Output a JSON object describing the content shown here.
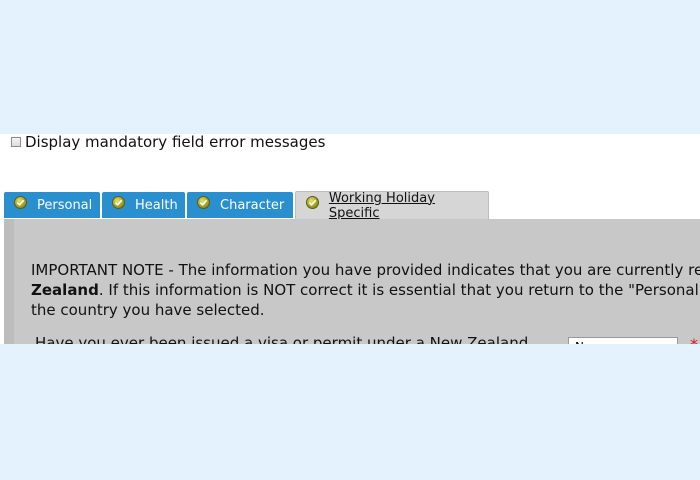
{
  "mandatory_checkbox": {
    "label": "Display mandatory field error messages",
    "checked": false
  },
  "tabs": [
    {
      "label": "Personal",
      "status_icon": "check-circle-icon",
      "active": false
    },
    {
      "label": "Health",
      "status_icon": "check-circle-icon",
      "active": false
    },
    {
      "label": "Character",
      "status_icon": "check-circle-icon",
      "active": false
    },
    {
      "label": "Working Holiday Specific",
      "status_icon": "check-circle-icon",
      "active": true
    }
  ],
  "panel": {
    "note_line1": "IMPORTANT NOTE - The information you have provided indicates that you are currently re",
    "note_line2_bold": "Zealand",
    "note_line2_rest": ". If this information is NOT correct it is essential that you return to the \"Personal",
    "note_line3": "the country you have selected.",
    "question": "Have you ever been issued a visa or permit under a New Zealand",
    "select_value": "N",
    "required_mark": "*"
  },
  "colors": {
    "page_background": "#e3f2fc",
    "tab_background": "#2a8fcf",
    "active_tab_background": "#d6d6d6",
    "panel_background": "#c8c8c8",
    "required_color": "#d81818"
  }
}
